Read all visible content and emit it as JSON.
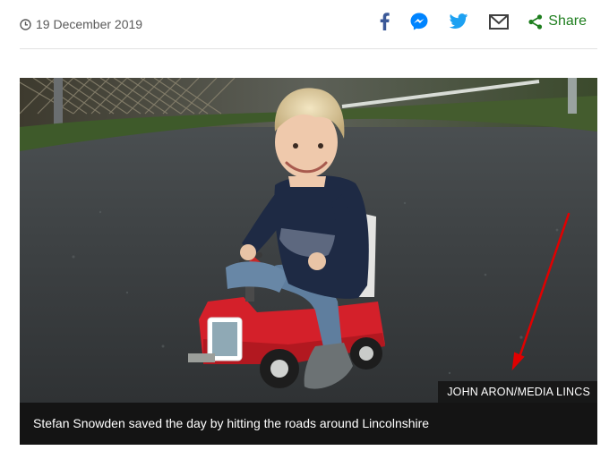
{
  "meta": {
    "date": "19 December 2019",
    "clock_icon": "clock-icon"
  },
  "share": {
    "icons": [
      "facebook-icon",
      "messenger-icon",
      "twitter-icon",
      "email-icon",
      "share-icon"
    ],
    "share_label": "Share",
    "colors": {
      "facebook": "#3b5998",
      "messenger": "#0084ff",
      "twitter": "#1da1f2",
      "email": "#404040",
      "share": "#1e7e1e"
    }
  },
  "image": {
    "credit": "JOHN ARON/MEDIA LINCS",
    "caption": "Stefan Snowden saved the day by hitting the roads around Lincolnshire",
    "annotation_color": "#e00000"
  }
}
